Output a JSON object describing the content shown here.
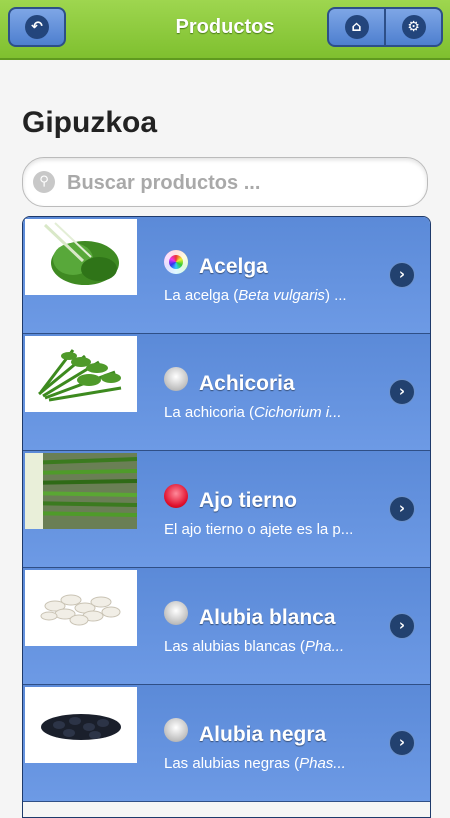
{
  "header": {
    "title": "Productos",
    "back_icon": "back-arrow-icon",
    "home_icon": "home-icon",
    "settings_icon": "gear-icon"
  },
  "page": {
    "title": "Gipuzkoa"
  },
  "search": {
    "placeholder": "Buscar productos ...",
    "value": "",
    "icon": "search-icon"
  },
  "colors": {
    "header_green": "#8ccc3c",
    "list_blue": "#6390dd",
    "button_blue": "#4e7fcf"
  },
  "products": [
    {
      "name": "Acelga",
      "desc_pre": "La acelga (",
      "desc_em": "Beta vulgaris",
      "desc_post": ") ...",
      "status": "rainbow",
      "image": "chard-leaves"
    },
    {
      "name": "Achicoria",
      "desc_pre": "La achicoria (",
      "desc_em": "Cichorium i...",
      "desc_post": "",
      "status": "grey",
      "image": "chicory-leaves"
    },
    {
      "name": "Ajo tierno",
      "desc_pre": "El ajo tierno o ajete es la p...",
      "desc_em": "",
      "desc_post": "",
      "status": "red",
      "image": "green-garlic"
    },
    {
      "name": "Alubia blanca",
      "desc_pre": "Las alubias blancas (",
      "desc_em": "Pha...",
      "desc_post": "",
      "status": "grey",
      "image": "white-beans"
    },
    {
      "name": "Alubia negra",
      "desc_pre": "Las alubias negras (",
      "desc_em": "Phas...",
      "desc_post": "",
      "status": "grey",
      "image": "black-beans"
    }
  ]
}
